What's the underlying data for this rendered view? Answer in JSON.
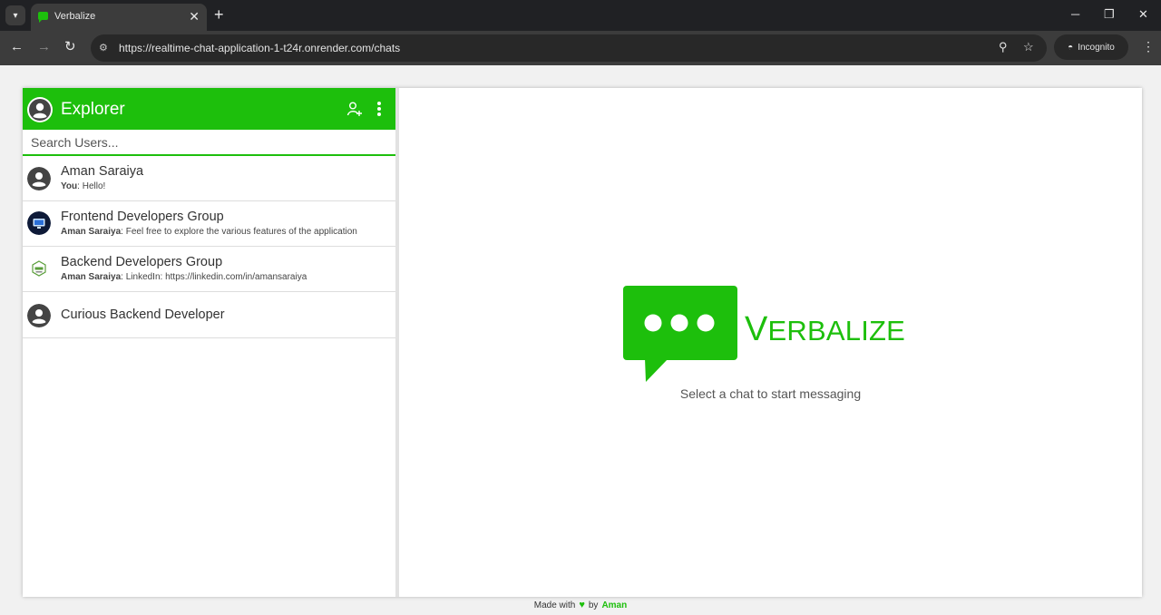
{
  "browser": {
    "tab_title": "Verbalize",
    "url": "https://realtime-chat-application-1-t24r.onrender.com/chats",
    "incognito_label": "Incognito"
  },
  "sidebar": {
    "title": "Explorer",
    "search_placeholder": "Search Users...",
    "chats": [
      {
        "name": "Aman Saraiya",
        "sender": "You",
        "separator": ": ",
        "message": "Hello!"
      },
      {
        "name": "Frontend Developers Group",
        "sender": "Aman Saraiya",
        "separator": ": ",
        "message": "Feel free to explore the various features of the application"
      },
      {
        "name": "Backend Developers Group",
        "sender": "Aman Saraiya",
        "separator": ": ",
        "message": "LinkedIn: https://linkedin.com/in/amansaraiya"
      },
      {
        "name": "Curious Backend Developer"
      }
    ]
  },
  "main": {
    "brand_initial": "V",
    "brand_rest": "ERBALIZE",
    "empty_message": "Select a chat to start messaging"
  },
  "footer": {
    "made_with": "Made with",
    "by": "by",
    "author": "Aman"
  },
  "colors": {
    "accent": "#1dbf0c"
  }
}
